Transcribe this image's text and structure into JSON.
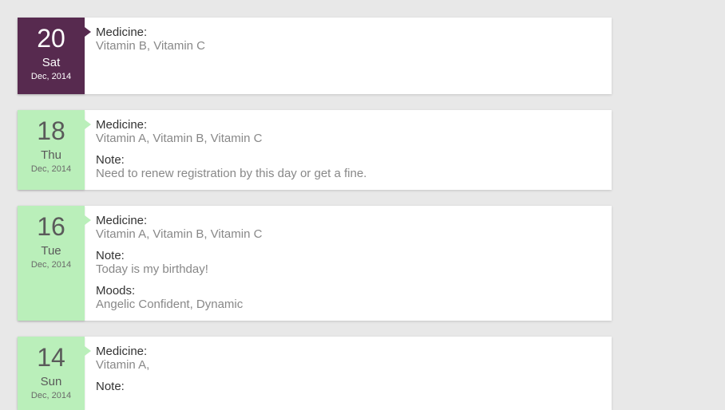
{
  "entries": [
    {
      "day_num": "20",
      "day_name": "Sat",
      "month_year": "Dec, 2014",
      "variant": "purple",
      "medicine_label": "Medicine:",
      "medicine_value": "Vitamin B, Vitamin C"
    },
    {
      "day_num": "18",
      "day_name": "Thu",
      "month_year": "Dec, 2014",
      "variant": "green",
      "medicine_label": "Medicine:",
      "medicine_value": "Vitamin A, Vitamin B, Vitamin C",
      "note_label": "Note:",
      "note_value": "Need to renew registration by this day or get a fine."
    },
    {
      "day_num": "16",
      "day_name": "Tue",
      "month_year": "Dec, 2014",
      "variant": "green",
      "medicine_label": "Medicine:",
      "medicine_value": "Vitamin A, Vitamin B, Vitamin C",
      "note_label": "Note:",
      "note_value": "Today is my birthday!",
      "moods_label": "Moods:",
      "moods_value": "Angelic Confident, Dynamic"
    },
    {
      "day_num": "14",
      "day_name": "Sun",
      "month_year": "Dec, 2014",
      "variant": "green",
      "medicine_label": "Medicine:",
      "medicine_value": "Vitamin A,",
      "note_label": "Note:"
    }
  ]
}
